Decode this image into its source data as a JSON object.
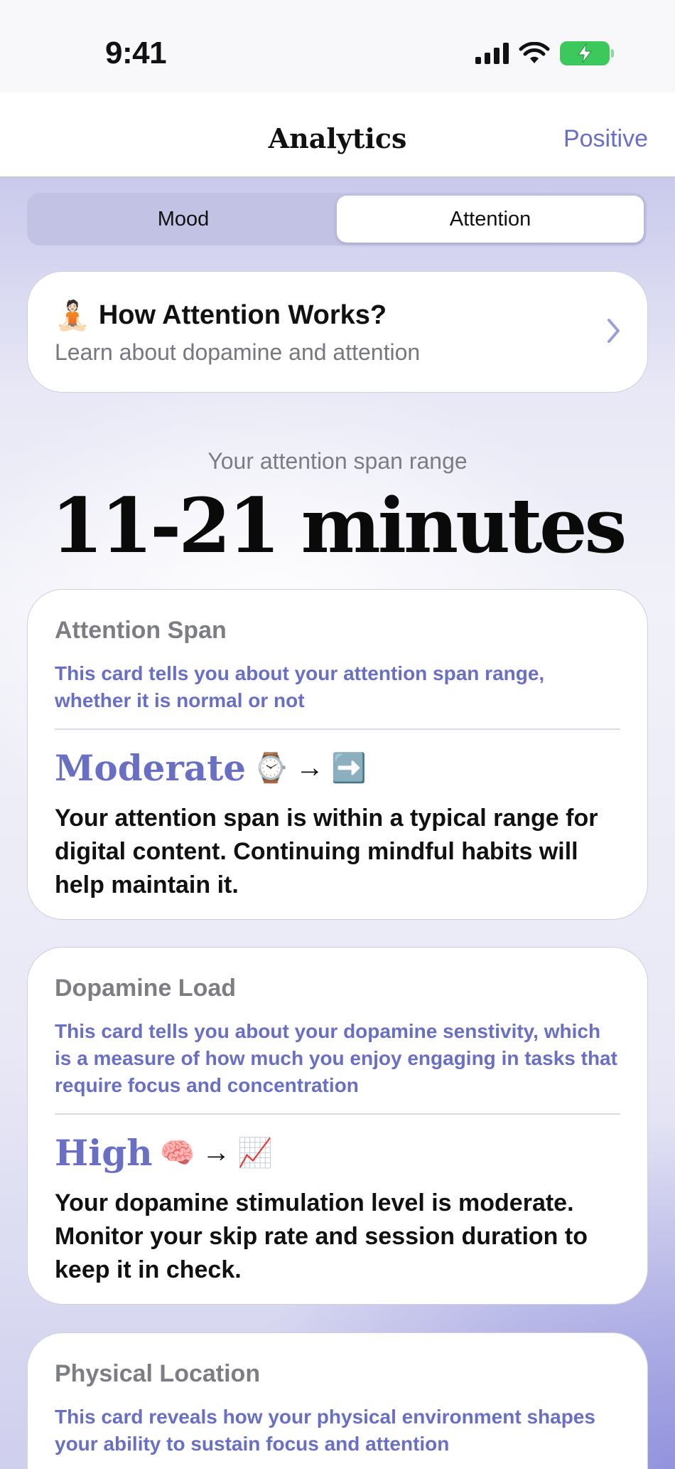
{
  "status": {
    "time": "9:41"
  },
  "nav": {
    "title": "Analytics",
    "right_label": "Positive"
  },
  "segments": [
    {
      "label": "Mood",
      "active": false
    },
    {
      "label": "Attention",
      "active": true
    }
  ],
  "learn": {
    "emoji": "🧘🏻",
    "title": "How Attention Works?",
    "subtitle": "Learn about dopamine and attention"
  },
  "span": {
    "label": "Your attention span range",
    "value": "11-21 minutes"
  },
  "cards": [
    {
      "title": "Attention Span",
      "description": "This card tells you about your attention span range, whether it is normal or not",
      "level": "Moderate",
      "emoji1": "⌚",
      "arrow": "→",
      "emoji2": "➡️",
      "body": "Your attention span is within a typical range for digital content. Continuing mindful habits will help maintain it."
    },
    {
      "title": "Dopamine Load",
      "description": "This card tells you about your dopamine senstivity, which is a measure of how much you enjoy engaging in tasks that require focus and concentration",
      "level": "High",
      "emoji1": "🧠",
      "arrow": "→",
      "emoji2": "📈",
      "body": "Your dopamine stimulation level is moderate. Monitor your skip rate and session duration to keep it in check."
    },
    {
      "title": "Physical Location",
      "description": "This card reveals how your physical environment shapes your ability to sustain focus and attention"
    }
  ],
  "colors": {
    "accent": "#6a6fc6",
    "battery": "#3cc85a"
  }
}
